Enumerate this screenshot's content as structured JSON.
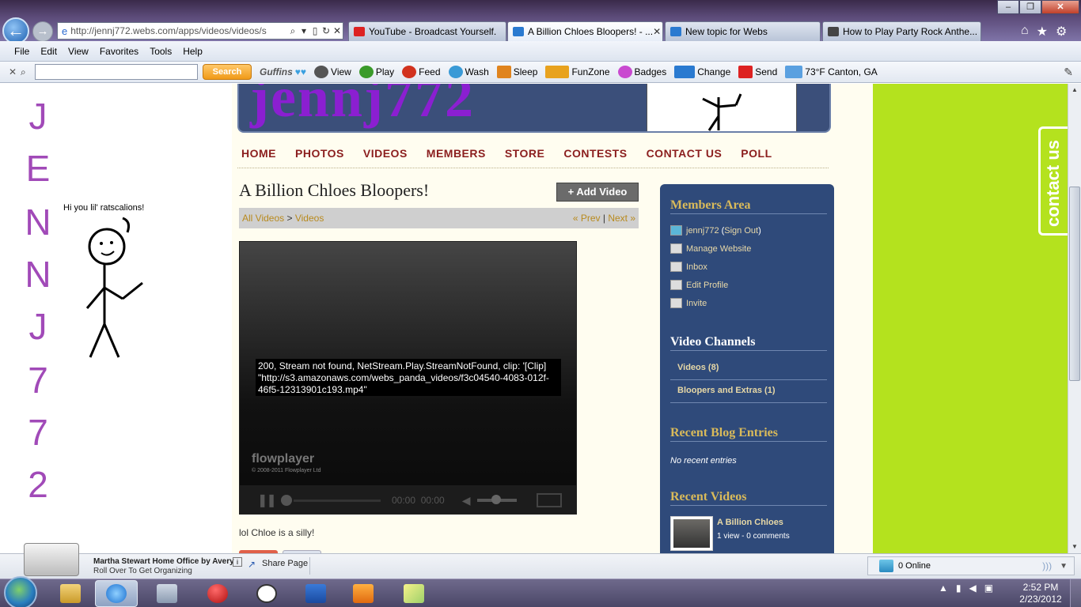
{
  "browser": {
    "address_url_host": "http://jennj772.webs.com",
    "address_url_path": "/apps/videos/videos/s",
    "tabs": [
      {
        "label": "YouTube - Broadcast Yourself.",
        "color": "#d22"
      },
      {
        "label": "A Billion Chloes Bloopers! - ...",
        "color": "#2a7ad0"
      },
      {
        "label": "New topic for Webs",
        "color": "#2a7ad0"
      },
      {
        "label": "How to Play Party Rock Anthe...",
        "color": "#444"
      }
    ],
    "window_buttons": [
      "–",
      "❐",
      "✕"
    ],
    "nav_icons": [
      "⌂",
      "★",
      "⚙"
    ]
  },
  "menu": [
    "File",
    "Edit",
    "View",
    "Favorites",
    "Tools",
    "Help"
  ],
  "toolbar": {
    "search_label": "Search",
    "items": [
      {
        "label": "Guffins",
        "color": "#777"
      },
      {
        "label": "View",
        "color": "#555"
      },
      {
        "label": "Play",
        "color": "#3a9a2a"
      },
      {
        "label": "Feed",
        "color": "#d2321e"
      },
      {
        "label": "Wash",
        "color": "#3a9ad6"
      },
      {
        "label": "Sleep",
        "color": "#e0841e"
      },
      {
        "label": "FunZone",
        "color": "#e8a21e"
      },
      {
        "label": "Badges",
        "color": "#c94ad0"
      },
      {
        "label": "Change",
        "color": "#2a7ad0"
      },
      {
        "label": "Send",
        "color": "#d22"
      },
      {
        "label": "73°F Canton, GA",
        "color": "#5aa0e0"
      }
    ]
  },
  "page": {
    "banner_text": "jennj772",
    "nav": [
      "HOME",
      "PHOTOS",
      "VIDEOS",
      "MEMBERS",
      "STORE",
      "CONTESTS",
      "CONTACT US",
      "POLL"
    ],
    "title": "A Billion Chloes Bloopers!",
    "add_video": "+ Add Video",
    "crumb_all": "All Videos",
    "crumb_sep": " > ",
    "crumb_videos": "Videos",
    "prev": "« Prev",
    "pipe": " | ",
    "next": "Next »",
    "player": {
      "error": "200, Stream not found, NetStream.Play.StreamNotFound, clip: '[Clip] \"http://s3.amazonaws.com/webs_panda_videos/f3c04540-4083-012f-46f5-12313901c193.mp4\"",
      "brand": "flowplayer",
      "copyright": "© 2008-2011 Flowplayer Ltd",
      "time": "00:00  00:00"
    },
    "caption": "lol Chloe is a silly!",
    "left_letters": [
      "J",
      "E",
      "N",
      "N",
      "J",
      "7",
      "7",
      "2"
    ],
    "speech": "Hi you lil' ratscalions!",
    "contact_tab": "contact us"
  },
  "sidebar": {
    "members_heading": "Members Area",
    "user": "jennj772",
    "signout_open": "(",
    "signout": "Sign Out",
    "signout_close": ")",
    "links": [
      "Manage Website",
      "Inbox",
      "Edit Profile",
      "Invite"
    ],
    "channels_heading": "Video Channels",
    "channels": [
      "Videos (8)",
      "Bloopers and Extras (1)"
    ],
    "blog_heading": "Recent Blog Entries",
    "blog_empty": "No recent entries",
    "recent_heading": "Recent Videos",
    "recent_title": "A Billion Chloes",
    "recent_meta": "1 view - 0 comments"
  },
  "statusbar": {
    "ad_title": "Martha Stewart Home Office by Avery",
    "ad_sub": "Roll Over To Get Organizing",
    "share": "Share Page",
    "online": "0 Online"
  },
  "taskbar": {
    "time": "2:52 PM",
    "date": "2/23/2012"
  }
}
